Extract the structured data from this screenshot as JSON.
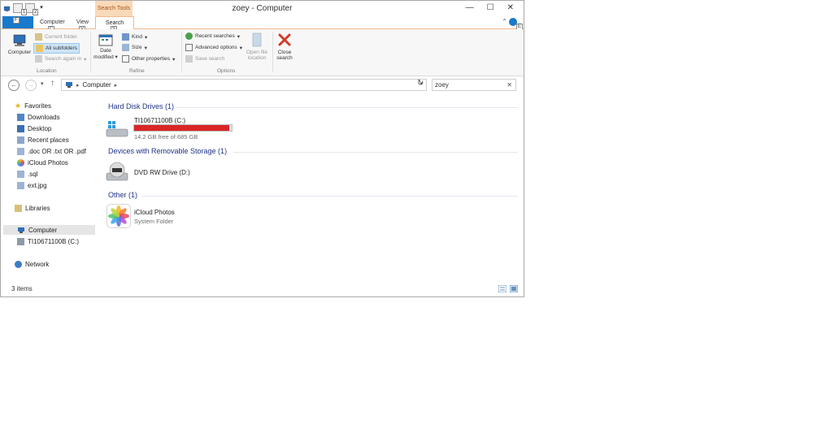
{
  "window": {
    "title": "zoey - Computer",
    "contextual_tab_group": "Search Tools",
    "controls": [
      "minimize",
      "maximize",
      "close"
    ]
  },
  "tabs": {
    "file": "F",
    "items": [
      "Computer",
      "View",
      "Search"
    ],
    "active": "Search",
    "keytips": {
      "quick_access_1": "1",
      "quick_access_2": "2",
      "computer": "C",
      "view": "V",
      "search": "S",
      "help": "E"
    }
  },
  "ribbon": {
    "location": {
      "computer_label": "Computer",
      "current_folder": "Current folder",
      "all_subfolders": "All subfolders",
      "search_again_in": "Search again in",
      "group_label": "Location"
    },
    "refine": {
      "date_modified_1": "Date",
      "date_modified_2": "modified",
      "kind": "Kind",
      "size": "Size",
      "other_properties": "Other properties",
      "group_label": "Refine"
    },
    "options": {
      "recent_searches": "Recent searches",
      "advanced_options": "Advanced options",
      "save_search": "Save search",
      "open_file_location_1": "Open file",
      "open_file_location_2": "location",
      "group_label": "Options"
    },
    "close": {
      "label_1": "Close",
      "label_2": "search"
    }
  },
  "address": {
    "path": "Computer",
    "search_value": "zoey"
  },
  "nav": {
    "favorites": "Favorites",
    "favorites_items": [
      "Downloads",
      "Desktop",
      "Recent places",
      ".doc OR .txt OR .pdf",
      "iCloud Photos",
      ".sql",
      "ext.jpg"
    ],
    "libraries": "Libraries",
    "computer": "Computer",
    "drive": "TI10671100B (C:)",
    "network": "Network"
  },
  "content": {
    "groups": [
      {
        "title": "Hard Disk Drives (1)"
      },
      {
        "title": "Devices with Removable Storage (1)"
      },
      {
        "title": "Other (1)"
      }
    ],
    "hdd": {
      "name": "TI10671100B (C:)",
      "free": "14.2 GB free of 685 GB",
      "used_fraction": 0.979
    },
    "dvd": {
      "name": "DVD RW Drive (D:)"
    },
    "other": {
      "name": "iCloud Photos",
      "type": "System Folder"
    }
  },
  "status": {
    "items": "3 items"
  },
  "colors": {
    "file_tab": "#1979ca",
    "search_tools": "#f8d9b8",
    "group_head": "#1e3287",
    "drive_bar": "#da2626"
  }
}
